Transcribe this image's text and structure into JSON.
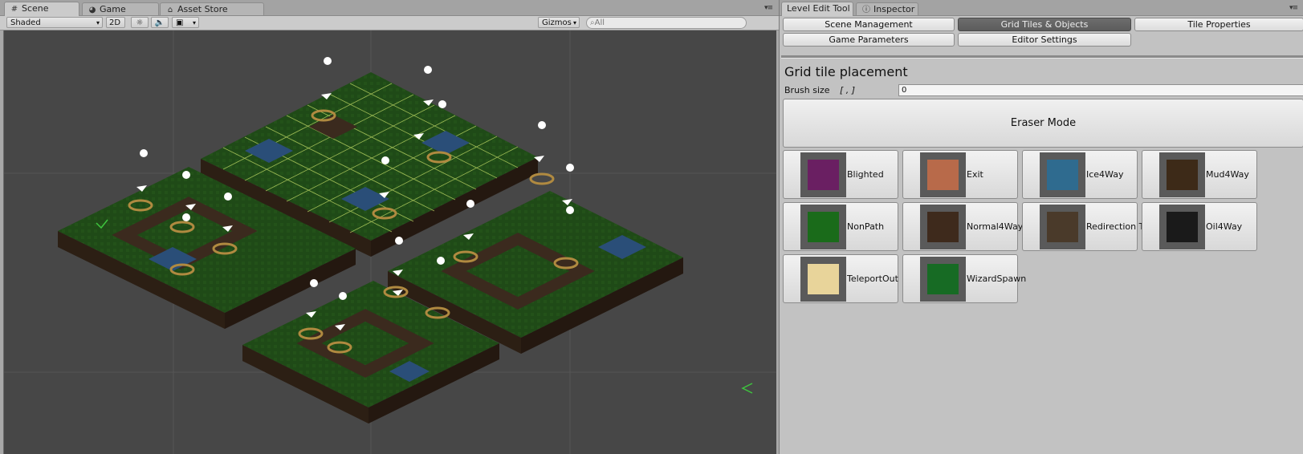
{
  "scene": {
    "tabs": [
      {
        "label": "Scene",
        "icon": "grid-icon"
      },
      {
        "label": "Game",
        "icon": "pacman-icon"
      },
      {
        "label": "Asset Store",
        "icon": "bag-icon"
      }
    ],
    "toolbar": {
      "shading": "Shaded",
      "mode_2d": "2D",
      "gizmos": "Gizmos",
      "search_placeholder": "All"
    },
    "colors": {
      "viewport_bg": "#474747",
      "grass": "#1f4a17",
      "path": "#3b2a1e",
      "water": "#2a4e78",
      "selection": "#c8e06a"
    }
  },
  "tool": {
    "tabs": [
      {
        "label": "Level Edit Tool",
        "icon": "none"
      },
      {
        "label": "Inspector",
        "icon": "info-icon"
      }
    ],
    "menu_row1": [
      "Scene Management",
      "Grid Tiles & Objects",
      "Tile Properties"
    ],
    "menu_row2": [
      "Game Parameters",
      "Editor Settings"
    ],
    "active_menu": "Grid Tiles & Objects",
    "heading": "Grid tile placement",
    "brush": {
      "label": "Brush size",
      "bracket": "[ , ]",
      "value": "0"
    },
    "eraser_label": "Eraser Mode",
    "tiles": [
      {
        "label": "Blighted",
        "color": "#6a1f62"
      },
      {
        "label": "Exit",
        "color": "#b86a4a"
      },
      {
        "label": "Ice4Way",
        "color": "#2f6b8f"
      },
      {
        "label": "Mud4Way",
        "color": "#3d2a18"
      },
      {
        "label": "NonPath",
        "color": "#1a6b1a"
      },
      {
        "label": "Normal4Way",
        "color": "#3e2a1c"
      },
      {
        "label": "Redirection Tile",
        "color": "#4a3a2a"
      },
      {
        "label": "Oil4Way",
        "color": "#1a1a1a"
      },
      {
        "label": "TeleportOut",
        "color": "#e8d49a"
      },
      {
        "label": "WizardSpawn",
        "color": "#176b24"
      }
    ]
  }
}
